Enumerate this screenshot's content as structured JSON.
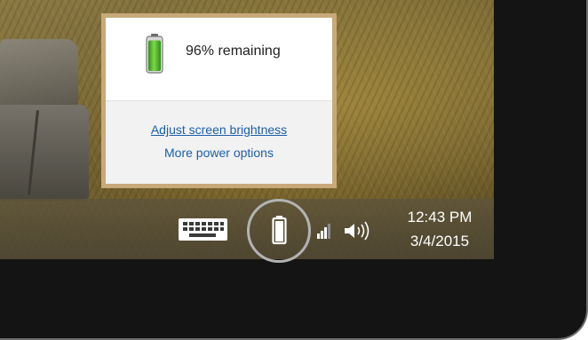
{
  "battery_flyout": {
    "status_text": "96% remaining",
    "battery_level_percent": 96,
    "links": [
      {
        "label": "Adjust screen brightness"
      },
      {
        "label": "More power options"
      }
    ]
  },
  "system_tray": {
    "icons": [
      "keyboard-icon",
      "battery-icon",
      "network-signal-icon",
      "volume-icon"
    ],
    "clock": {
      "time": "12:43 PM",
      "date": "3/4/2015"
    }
  },
  "colors": {
    "battery_fill": "#4caf2a",
    "link": "#1c5fa8",
    "flyout_border": "#c8a97a"
  }
}
